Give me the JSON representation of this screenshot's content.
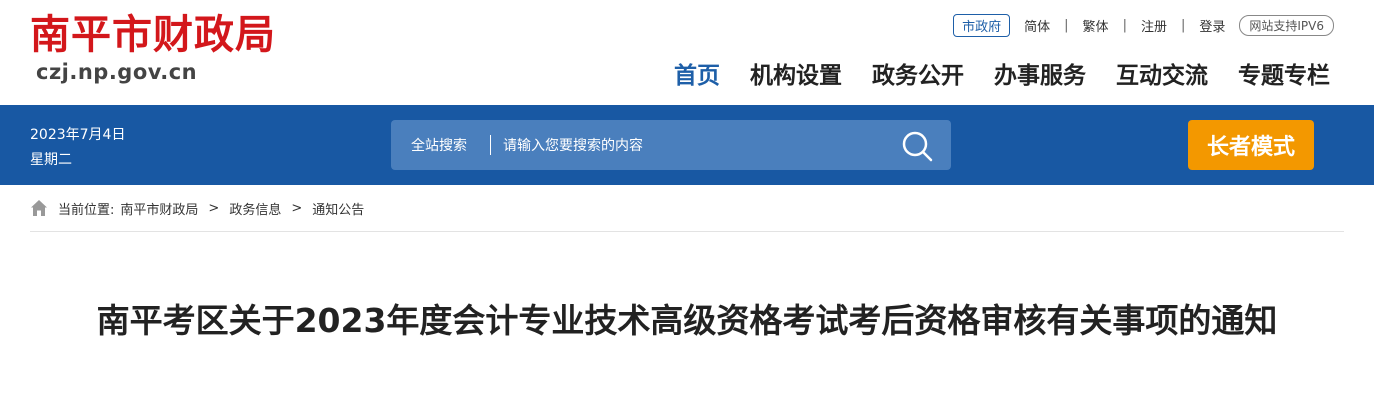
{
  "site": {
    "name": "南平市财政局",
    "domain": "czj.np.gov.cn"
  },
  "toplinks": {
    "city_gov": "市政府",
    "simplified": "简体",
    "traditional": "繁体",
    "register": "注册",
    "login": "登录",
    "ipv6": "网站支持IPV6"
  },
  "nav": [
    "首页",
    "机构设置",
    "政务公开",
    "办事服务",
    "互动交流",
    "专题专栏"
  ],
  "date": {
    "date": "2023年7月4日",
    "weekday": "星期二"
  },
  "search": {
    "label": "全站搜索",
    "placeholder": "请输入您要搜索的内容"
  },
  "elder_mode": "长者模式",
  "breadcrumb": {
    "prefix": "当前位置:",
    "items": [
      "南平市财政局",
      "政务信息",
      "通知公告"
    ],
    "separator": ">"
  },
  "article": {
    "title": "南平考区关于2023年度会计专业技术高级资格考试考后资格审核有关事项的通知"
  },
  "colors": {
    "brand_red": "#d3171b",
    "bar_blue": "#1858a3",
    "elder_orange": "#f39800"
  }
}
